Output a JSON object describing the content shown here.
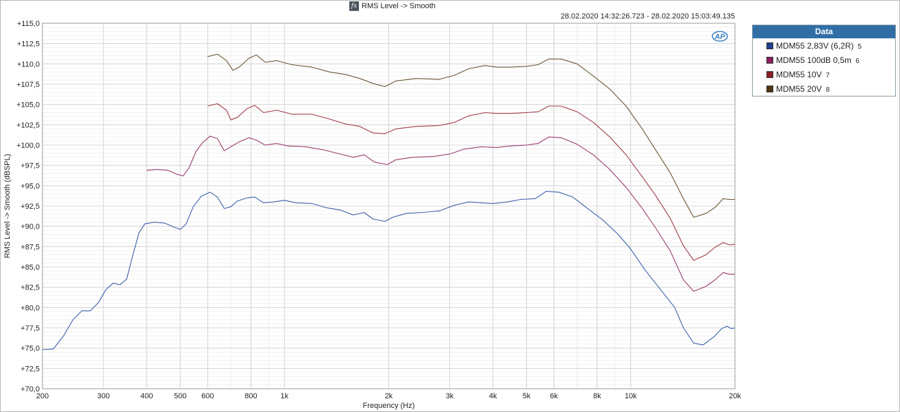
{
  "title": "RMS Level -> Smooth",
  "timestamp": "28.02.2020 14:32:26.723 - 28.02.2020 15:03:49.135",
  "logo_text": "AP",
  "legend": {
    "header": "Data",
    "items": [
      {
        "label": "MDM55 2,83V (6,2R)",
        "num": "5",
        "color": "#1f3f8f"
      },
      {
        "label": "MDM55 100dB 0,5m",
        "num": "6",
        "color": "#8c1f5c"
      },
      {
        "label": "MDM55 10V",
        "num": "7",
        "color": "#8c1f23"
      },
      {
        "label": "MDM55 20V",
        "num": "8",
        "color": "#4d3610"
      }
    ]
  },
  "chart_data": {
    "type": "line",
    "title": "RMS Level -> Smooth",
    "xlabel": "Frequency (Hz)",
    "ylabel": "RMS Level -> Smooth (dBSPL)",
    "xscale": "log",
    "xlim": [
      200,
      20000
    ],
    "ylim": [
      70,
      115
    ],
    "grid": true,
    "legend_position": "right",
    "x_ticks": [
      {
        "v": 200,
        "label": "200"
      },
      {
        "v": 300,
        "label": "300"
      },
      {
        "v": 400,
        "label": "400"
      },
      {
        "v": 500,
        "label": "500"
      },
      {
        "v": 600,
        "label": "600"
      },
      {
        "v": 800,
        "label": "800"
      },
      {
        "v": 1000,
        "label": "1k"
      },
      {
        "v": 2000,
        "label": "2k"
      },
      {
        "v": 3000,
        "label": "3k"
      },
      {
        "v": 4000,
        "label": "4k"
      },
      {
        "v": 5000,
        "label": "5k"
      },
      {
        "v": 6000,
        "label": "6k"
      },
      {
        "v": 8000,
        "label": "8k"
      },
      {
        "v": 10000,
        "label": "10k"
      },
      {
        "v": 20000,
        "label": "20k"
      }
    ],
    "y_ticks": [
      {
        "v": 115,
        "label": "+115,0"
      },
      {
        "v": 112.5,
        "label": "+112,5"
      },
      {
        "v": 110,
        "label": "+110,0"
      },
      {
        "v": 107.5,
        "label": "+107,5"
      },
      {
        "v": 105,
        "label": "+105,0"
      },
      {
        "v": 102.5,
        "label": "+102,5"
      },
      {
        "v": 100,
        "label": "+100,0"
      },
      {
        "v": 97.5,
        "label": "+97,5"
      },
      {
        "v": 95,
        "label": "+95,0"
      },
      {
        "v": 92.5,
        "label": "+92,5"
      },
      {
        "v": 90,
        "label": "+90,0"
      },
      {
        "v": 87.5,
        "label": "+87,5"
      },
      {
        "v": 85,
        "label": "+85,0"
      },
      {
        "v": 82.5,
        "label": "+82,5"
      },
      {
        "v": 80,
        "label": "+80,0"
      },
      {
        "v": 77.5,
        "label": "+77,5"
      },
      {
        "v": 75,
        "label": "+75,0"
      },
      {
        "v": 72.5,
        "label": "+72,5"
      },
      {
        "v": 70,
        "label": "+70,0"
      }
    ],
    "series": [
      {
        "name": "MDM55 2,83V (6,2R) 5",
        "color": "#3b5ea8",
        "points": [
          [
            200,
            74.8
          ],
          [
            215,
            74.9
          ],
          [
            230,
            76.5
          ],
          [
            245,
            78.5
          ],
          [
            260,
            79.6
          ],
          [
            275,
            79.6
          ],
          [
            290,
            80.6
          ],
          [
            305,
            82.2
          ],
          [
            320,
            83.0
          ],
          [
            335,
            82.8
          ],
          [
            350,
            83.5
          ],
          [
            365,
            86.5
          ],
          [
            380,
            89.2
          ],
          [
            395,
            90.3
          ],
          [
            420,
            90.5
          ],
          [
            450,
            90.4
          ],
          [
            480,
            89.9
          ],
          [
            500,
            89.6
          ],
          [
            520,
            90.3
          ],
          [
            545,
            92.4
          ],
          [
            575,
            93.7
          ],
          [
            610,
            94.2
          ],
          [
            640,
            93.6
          ],
          [
            670,
            92.2
          ],
          [
            700,
            92.4
          ],
          [
            730,
            93.1
          ],
          [
            780,
            93.5
          ],
          [
            820,
            93.6
          ],
          [
            870,
            92.9
          ],
          [
            930,
            93.0
          ],
          [
            1000,
            93.2
          ],
          [
            1080,
            92.9
          ],
          [
            1200,
            92.8
          ],
          [
            1320,
            92.3
          ],
          [
            1450,
            92.0
          ],
          [
            1580,
            91.4
          ],
          [
            1700,
            91.7
          ],
          [
            1800,
            90.9
          ],
          [
            1950,
            90.6
          ],
          [
            2050,
            91.1
          ],
          [
            2250,
            91.6
          ],
          [
            2500,
            91.7
          ],
          [
            2800,
            91.9
          ],
          [
            3100,
            92.6
          ],
          [
            3400,
            93.0
          ],
          [
            3700,
            92.9
          ],
          [
            4000,
            92.8
          ],
          [
            4400,
            93.0
          ],
          [
            4800,
            93.3
          ],
          [
            5300,
            93.4
          ],
          [
            5700,
            94.3
          ],
          [
            6200,
            94.2
          ],
          [
            6800,
            93.6
          ],
          [
            7500,
            92.2
          ],
          [
            8300,
            90.8
          ],
          [
            9200,
            89.0
          ],
          [
            10000,
            87.2
          ],
          [
            11000,
            84.6
          ],
          [
            12200,
            82.2
          ],
          [
            13400,
            80.0
          ],
          [
            14200,
            77.5
          ],
          [
            15200,
            75.6
          ],
          [
            16200,
            75.4
          ],
          [
            17500,
            76.5
          ],
          [
            18300,
            77.4
          ],
          [
            19000,
            77.7
          ],
          [
            19500,
            77.4
          ],
          [
            20000,
            77.5
          ]
        ]
      },
      {
        "name": "MDM55 100dB 0,5m 6",
        "color": "#9c3a6e",
        "points": [
          [
            400,
            96.9
          ],
          [
            430,
            97.0
          ],
          [
            460,
            96.9
          ],
          [
            490,
            96.4
          ],
          [
            510,
            96.2
          ],
          [
            530,
            97.2
          ],
          [
            555,
            99.2
          ],
          [
            580,
            100.3
          ],
          [
            610,
            101.1
          ],
          [
            640,
            100.8
          ],
          [
            670,
            99.3
          ],
          [
            700,
            99.8
          ],
          [
            740,
            100.4
          ],
          [
            790,
            100.9
          ],
          [
            830,
            100.6
          ],
          [
            880,
            100.0
          ],
          [
            950,
            100.2
          ],
          [
            1020,
            99.9
          ],
          [
            1150,
            99.8
          ],
          [
            1300,
            99.4
          ],
          [
            1450,
            98.9
          ],
          [
            1580,
            98.5
          ],
          [
            1700,
            98.8
          ],
          [
            1820,
            97.9
          ],
          [
            1980,
            97.6
          ],
          [
            2100,
            98.2
          ],
          [
            2350,
            98.5
          ],
          [
            2700,
            98.6
          ],
          [
            3000,
            98.9
          ],
          [
            3300,
            99.5
          ],
          [
            3700,
            99.8
          ],
          [
            4100,
            99.7
          ],
          [
            4500,
            99.9
          ],
          [
            5000,
            100.0
          ],
          [
            5400,
            100.2
          ],
          [
            5800,
            101.0
          ],
          [
            6300,
            100.9
          ],
          [
            7000,
            100.1
          ],
          [
            7800,
            98.8
          ],
          [
            8700,
            97.0
          ],
          [
            9700,
            94.8
          ],
          [
            10800,
            92.2
          ],
          [
            11800,
            89.8
          ],
          [
            13000,
            87.0
          ],
          [
            14200,
            83.4
          ],
          [
            15200,
            82.0
          ],
          [
            16500,
            82.6
          ],
          [
            17500,
            83.4
          ],
          [
            18500,
            84.3
          ],
          [
            19300,
            84.1
          ],
          [
            20000,
            84.1
          ]
        ]
      },
      {
        "name": "MDM55 10V 7",
        "color": "#a03a46",
        "points": [
          [
            600,
            104.8
          ],
          [
            640,
            105.1
          ],
          [
            680,
            104.3
          ],
          [
            700,
            103.1
          ],
          [
            730,
            103.4
          ],
          [
            780,
            104.5
          ],
          [
            820,
            104.9
          ],
          [
            870,
            104.0
          ],
          [
            950,
            104.3
          ],
          [
            1050,
            103.8
          ],
          [
            1200,
            103.8
          ],
          [
            1350,
            103.2
          ],
          [
            1500,
            102.6
          ],
          [
            1650,
            102.3
          ],
          [
            1800,
            101.5
          ],
          [
            1950,
            101.4
          ],
          [
            2100,
            102.0
          ],
          [
            2400,
            102.3
          ],
          [
            2800,
            102.4
          ],
          [
            3100,
            102.8
          ],
          [
            3400,
            103.6
          ],
          [
            3800,
            104.0
          ],
          [
            4100,
            103.9
          ],
          [
            4500,
            103.9
          ],
          [
            5000,
            104.0
          ],
          [
            5400,
            104.1
          ],
          [
            5800,
            104.8
          ],
          [
            6300,
            104.8
          ],
          [
            7000,
            104.1
          ],
          [
            7800,
            102.8
          ],
          [
            8700,
            101.0
          ],
          [
            9700,
            98.8
          ],
          [
            10800,
            96.1
          ],
          [
            11800,
            93.8
          ],
          [
            13000,
            91.0
          ],
          [
            14200,
            87.6
          ],
          [
            15200,
            85.8
          ],
          [
            16500,
            86.5
          ],
          [
            17500,
            87.4
          ],
          [
            18500,
            88.0
          ],
          [
            19300,
            87.7
          ],
          [
            20000,
            87.8
          ]
        ]
      },
      {
        "name": "MDM55 20V 8",
        "color": "#6b5434",
        "points": [
          [
            600,
            110.9
          ],
          [
            640,
            111.2
          ],
          [
            680,
            110.4
          ],
          [
            710,
            109.2
          ],
          [
            740,
            109.6
          ],
          [
            790,
            110.7
          ],
          [
            830,
            111.1
          ],
          [
            880,
            110.2
          ],
          [
            950,
            110.4
          ],
          [
            1050,
            109.9
          ],
          [
            1200,
            109.6
          ],
          [
            1350,
            109.0
          ],
          [
            1500,
            108.7
          ],
          [
            1650,
            108.2
          ],
          [
            1800,
            107.6
          ],
          [
            1950,
            107.2
          ],
          [
            2100,
            107.9
          ],
          [
            2400,
            108.2
          ],
          [
            2800,
            108.1
          ],
          [
            3100,
            108.6
          ],
          [
            3400,
            109.4
          ],
          [
            3800,
            109.8
          ],
          [
            4100,
            109.6
          ],
          [
            4500,
            109.6
          ],
          [
            5000,
            109.7
          ],
          [
            5400,
            109.9
          ],
          [
            5800,
            110.6
          ],
          [
            6300,
            110.6
          ],
          [
            7000,
            110.0
          ],
          [
            7800,
            108.5
          ],
          [
            8700,
            106.9
          ],
          [
            9700,
            104.8
          ],
          [
            10800,
            102.0
          ],
          [
            11800,
            99.4
          ],
          [
            13000,
            96.6
          ],
          [
            14200,
            93.4
          ],
          [
            15200,
            91.1
          ],
          [
            16500,
            91.6
          ],
          [
            17500,
            92.3
          ],
          [
            18500,
            93.4
          ],
          [
            19300,
            93.3
          ],
          [
            20000,
            93.3
          ]
        ]
      }
    ]
  }
}
